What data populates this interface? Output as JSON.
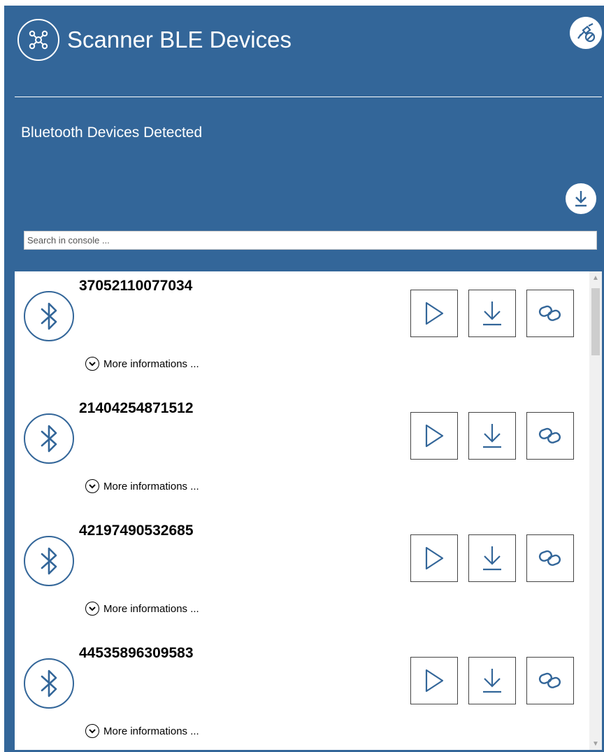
{
  "header": {
    "title": "Scanner BLE Devices",
    "app_icon": "network-hub-icon",
    "settings_icon": "satellite-off-icon"
  },
  "section": {
    "title": "Bluetooth Devices Detected",
    "download_icon": "download-circle-icon"
  },
  "search": {
    "placeholder": "Search in console ...",
    "value": ""
  },
  "devices": [
    {
      "name": "37052110077034",
      "more_label": "More informations ..."
    },
    {
      "name": "21404254871512",
      "more_label": "More informations ..."
    },
    {
      "name": "42197490532685",
      "more_label": "More informations ..."
    },
    {
      "name": "44535896309583",
      "more_label": "More informations ..."
    }
  ],
  "device_actions": [
    "play-icon",
    "download-icon",
    "link-icon"
  ],
  "colors": {
    "header_bg": "#336699",
    "accent": "#336699",
    "panel_bg": "#ffffff"
  }
}
